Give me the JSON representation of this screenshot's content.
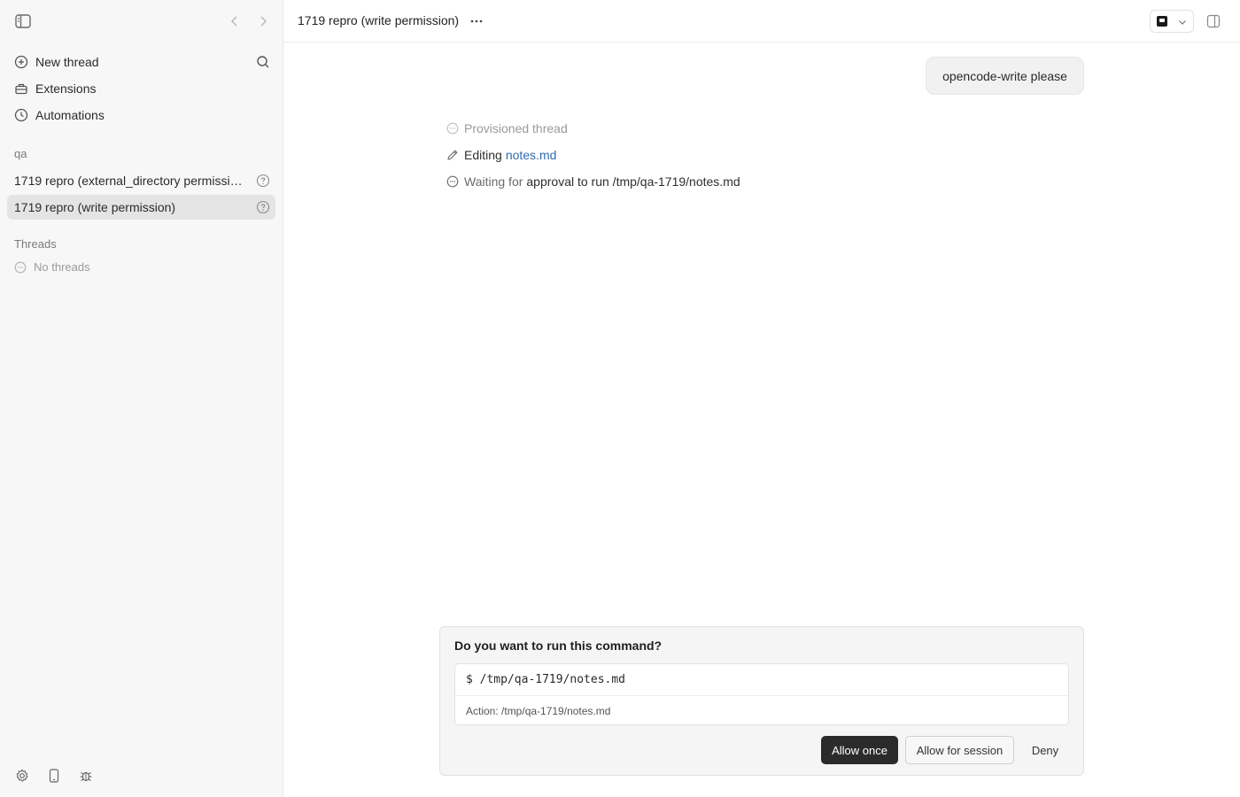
{
  "sidebar": {
    "nav": [
      {
        "label": "New thread",
        "icon": "plus-circle-icon"
      },
      {
        "label": "Extensions",
        "icon": "toolbox-icon"
      },
      {
        "label": "Automations",
        "icon": "clock-icon"
      }
    ],
    "project_label": "qa",
    "project_threads": [
      {
        "label": "1719 repro (external_directory permissio…",
        "status_icon": "question-circle-icon",
        "active": false
      },
      {
        "label": "1719 repro (write permission)",
        "status_icon": "question-circle-icon",
        "active": true
      }
    ],
    "threads_label": "Threads",
    "no_threads_label": "No threads"
  },
  "header": {
    "title": "1719 repro (write permission)"
  },
  "conversation": {
    "user_message": "opencode-write please",
    "steps": {
      "provisioned": "Provisioned thread",
      "editing_verb": "Editing",
      "editing_file": "notes.md",
      "waiting_prefix": "Waiting for",
      "waiting_detail": "approval to run /tmp/qa-1719/notes.md"
    }
  },
  "approval": {
    "question": "Do you want to run this command?",
    "command": "$ /tmp/qa-1719/notes.md",
    "action": "Action: /tmp/qa-1719/notes.md",
    "allow_once": "Allow once",
    "allow_session": "Allow for session",
    "deny": "Deny"
  },
  "colors": {
    "sidebar_bg": "#f7f7f7",
    "active_thread_bg": "#e4e4e4",
    "link": "#2f6bb3",
    "primary_button": "#2b2b2b"
  }
}
